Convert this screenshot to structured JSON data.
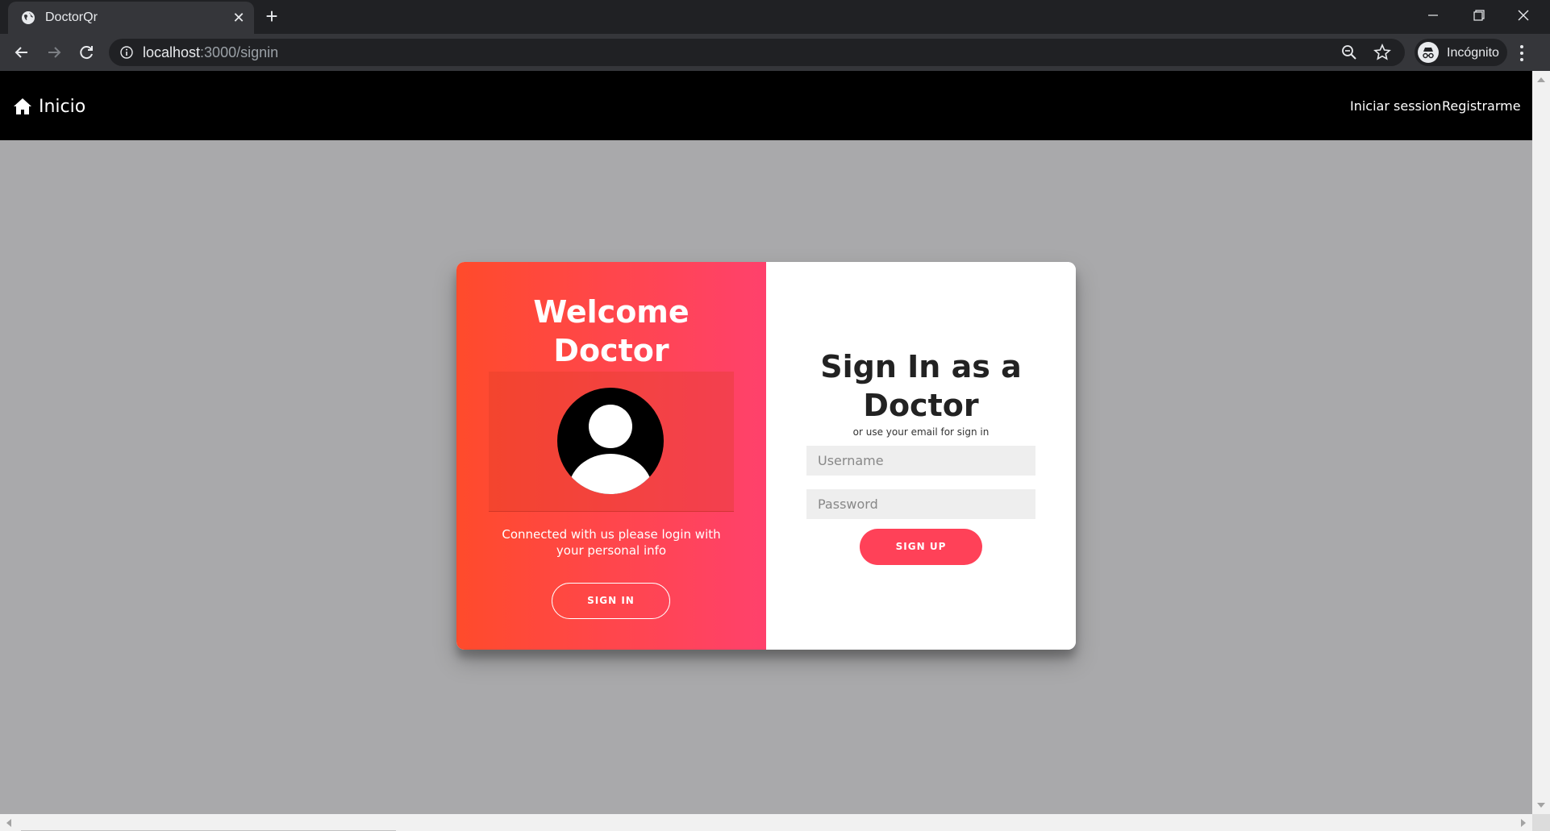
{
  "browser": {
    "tab_title": "DoctorQr",
    "url_host": "localhost",
    "url_path": ":3000/signin",
    "profile_label": "Incógnito"
  },
  "navbar": {
    "brand": "Inicio",
    "links": [
      "Iniciar session",
      "Registrarme"
    ]
  },
  "overlay": {
    "title_line1": "Welcome",
    "title_line2": "Doctor",
    "text_line1": "Connected with us please login with",
    "text_line2": "your personal info",
    "button": "SIGN IN"
  },
  "form": {
    "title_line1": "Sign In as a",
    "title_line2": "Doctor",
    "subtitle": "or use your email for sign in",
    "username_placeholder": "Username",
    "password_placeholder": "Password",
    "button": "SIGN UP"
  },
  "colors": {
    "gradient_start": "#ff4b2b",
    "gradient_end": "#ff416c",
    "button_primary": "#ff4158",
    "navbar": "#000000",
    "page_bg": "#a9a9ab"
  },
  "icons": [
    "globe-icon",
    "close-icon",
    "plus-icon",
    "back-icon",
    "forward-icon",
    "reload-icon",
    "info-icon",
    "zoom-icon",
    "star-icon",
    "incognito-icon",
    "menu-icon",
    "home-icon",
    "avatar-icon"
  ]
}
